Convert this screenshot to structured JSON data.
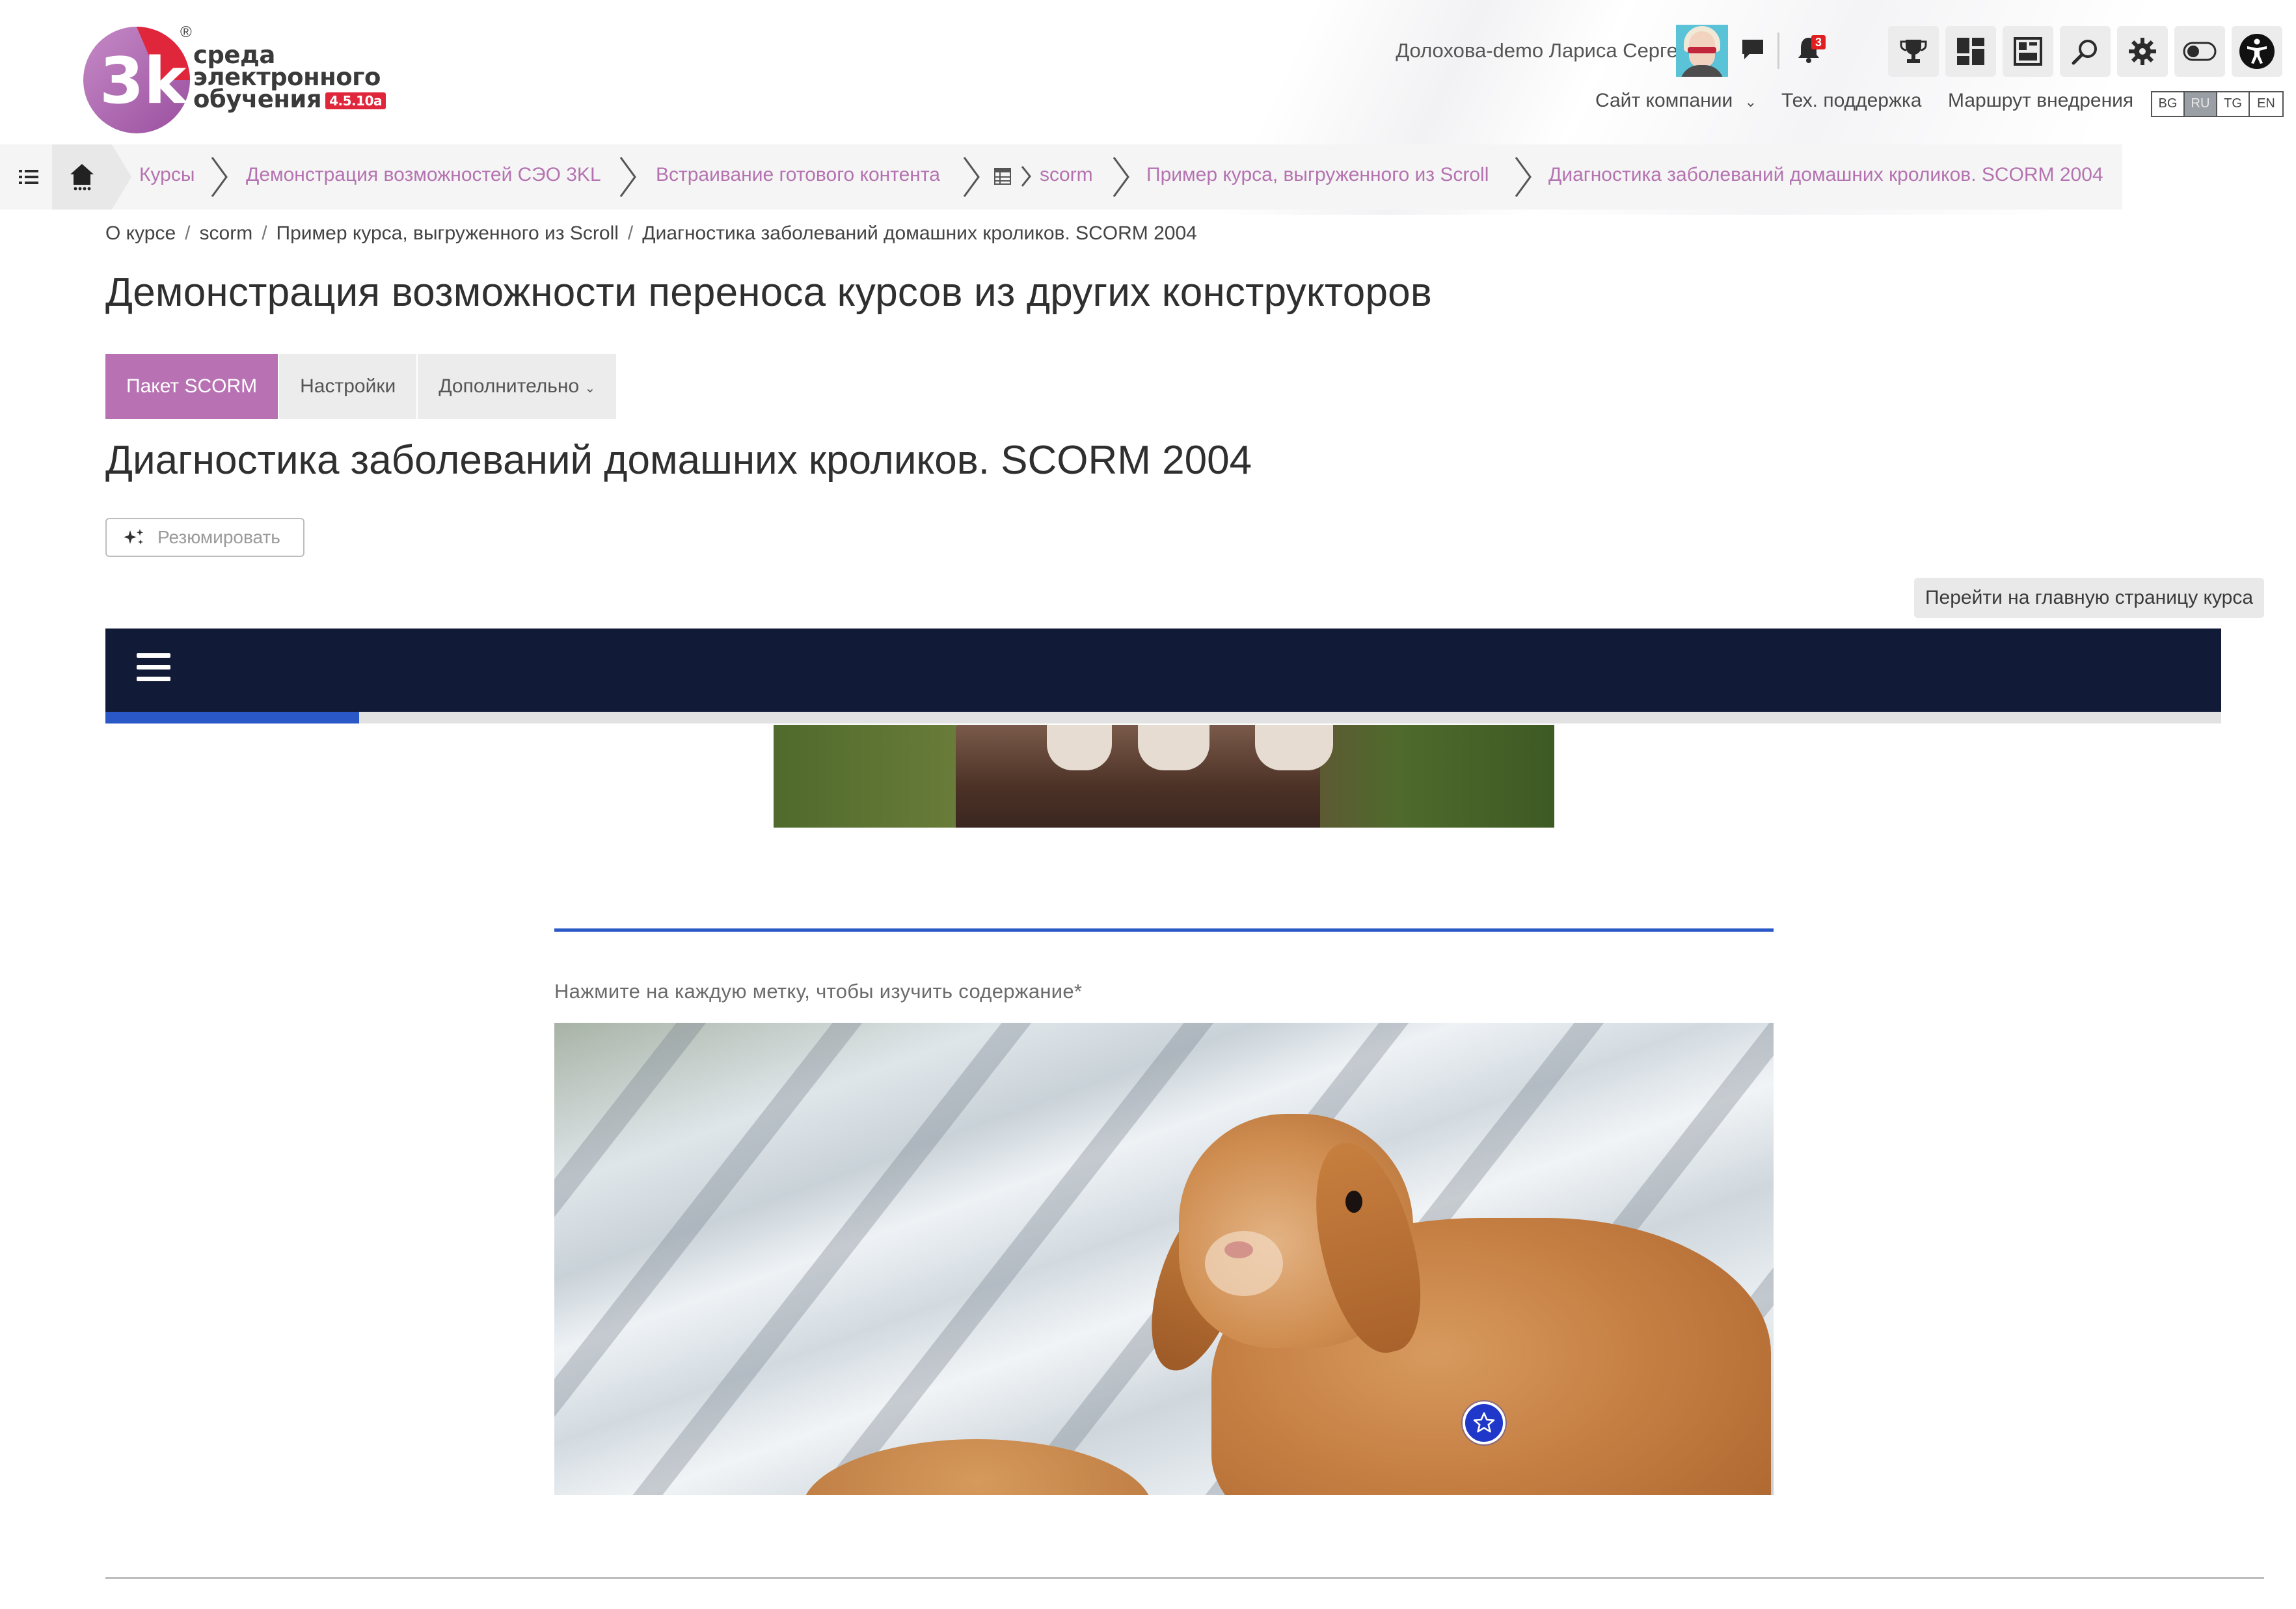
{
  "logo": {
    "line1": "среда",
    "line2": "электронного",
    "line3": "обучения",
    "version": "4.5.10a",
    "reg": "®",
    "mark_letters": "3k"
  },
  "header": {
    "user_name": "Долохова-demo Лариса Сергеевна",
    "notification_count": "3",
    "links": {
      "company_site": "Сайт компании",
      "support": "Тех. поддержка",
      "route": "Маршрут внедрения"
    },
    "languages": [
      "BG",
      "RU",
      "TG",
      "EN"
    ],
    "active_language": "RU",
    "icons": [
      "chat-icon",
      "bell-icon",
      "trophy-icon",
      "dashboard-icon",
      "grades-icon",
      "search-icon",
      "gear-icon",
      "toggle-icon",
      "accessibility-icon"
    ]
  },
  "breadcrumb": {
    "items": [
      "Курсы",
      "Демонстрация возможностей СЭО 3KL",
      "Встраивание готового контента",
      "scorm",
      "Пример курса, выгруженного из Scroll",
      "Диагностика заболеваний домашних кроликов. SCORM 2004"
    ]
  },
  "sub_breadcrumb": {
    "items": [
      "О курсе",
      "scorm",
      "Пример курса, выгруженного из Scroll",
      "Диагностика заболеваний домашних кроликов. SCORM 2004"
    ],
    "separator": "/"
  },
  "page": {
    "title": "Демонстрация возможности переноса курсов из других конструкторов",
    "tabs": [
      "Пакет SCORM",
      "Настройки",
      "Дополнительно"
    ],
    "active_tab": "Пакет SCORM",
    "scorm_title": "Диагностика заболеваний домашних кроликов. SCORM 2004",
    "summarize_button": "Резюмировать",
    "goto_course_button": "Перейти на главную страницу курса"
  },
  "player": {
    "progress": 0.12,
    "instruction": "Нажмите на каждую метку, чтобы изучить содержание*"
  },
  "colors": {
    "accent": "#b872b3",
    "player_bar": "#111a36",
    "progress": "#2a58c6",
    "hotspot": "#1f38c9"
  }
}
